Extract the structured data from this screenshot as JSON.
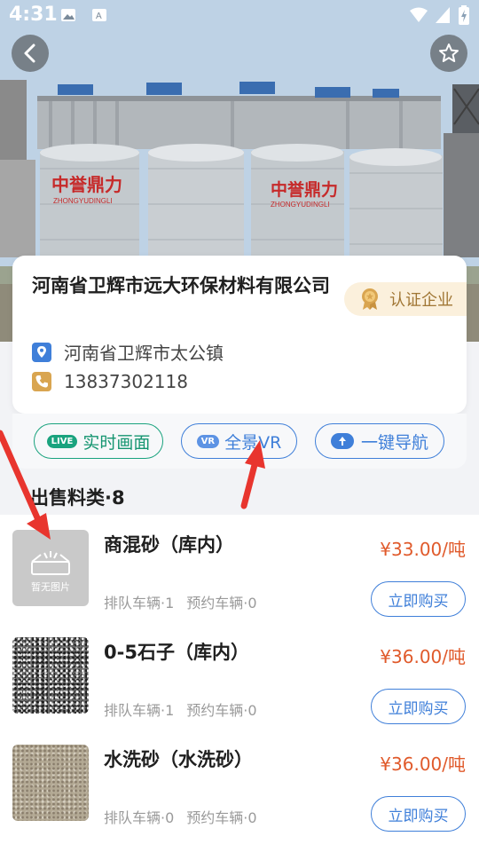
{
  "status_bar": {
    "time": "4:31"
  },
  "hero": {
    "silo_text_1": "中誉鼎力",
    "silo_text_2": "中誉鼎力",
    "silo_sub_1": "ZHONGYUDINGLI",
    "silo_sub_2": "ZHONGYUDINGLI"
  },
  "company": {
    "name": "河南省卫辉市远大环保材料有限公司",
    "cert_label": "认证企业",
    "address": "河南省卫辉市太公镇",
    "phone": "13837302118"
  },
  "actions": {
    "live": {
      "tag": "LIVE",
      "label": "实时画面"
    },
    "vr": {
      "tag": "VR",
      "label": "全景VR"
    },
    "nav": {
      "label": "一键导航"
    }
  },
  "section": {
    "title": "出售料类·8"
  },
  "products": [
    {
      "name": "商混砂（库内）",
      "price": "¥33.00/吨",
      "queue": "排队车辆·1",
      "reserve": "预约车辆·0",
      "buy_label": "立即购买",
      "image_placeholder": "暂无图片"
    },
    {
      "name": "0-5石子（库内）",
      "price": "¥36.00/吨",
      "queue": "排队车辆·1",
      "reserve": "预约车辆·0",
      "buy_label": "立即购买"
    },
    {
      "name": "水洗砂（水洗砂）",
      "price": "¥36.00/吨",
      "queue": "排队车辆·0",
      "reserve": "预约车辆·0",
      "buy_label": "立即购买"
    }
  ],
  "colors": {
    "accent_blue": "#3f7fd9",
    "live_green": "#1aa37e",
    "price_orange": "#e05a2b",
    "cert_gold": "#a07634"
  },
  "icons": [
    "back-icon",
    "star-icon",
    "location-pin-icon",
    "phone-icon",
    "medal-icon",
    "navigation-icon",
    "image-placeholder-icon"
  ]
}
